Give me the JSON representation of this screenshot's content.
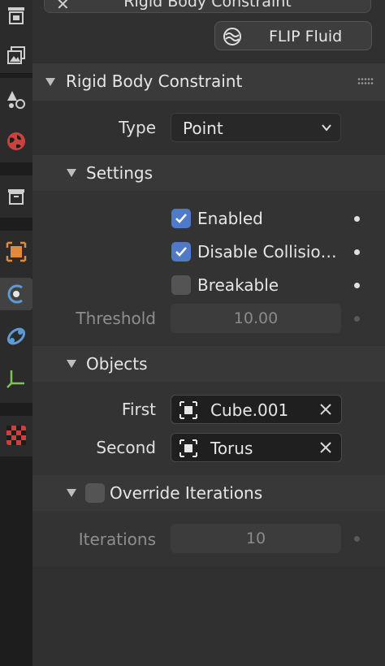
{
  "top_strip": {
    "close_glyph": "✕",
    "label": "Rigid Body Constraint"
  },
  "flip_button": {
    "label": "FLIP Fluid",
    "icon": "flip-fluid-icon"
  },
  "panel": {
    "title": "Rigid Body Constraint"
  },
  "type_row": {
    "label": "Type",
    "value": "Point"
  },
  "settings": {
    "title": "Settings",
    "enabled": {
      "label": "Enabled",
      "checked": true
    },
    "disable_collisions": {
      "label": "Disable Collisio…",
      "checked": true
    },
    "breakable": {
      "label": "Breakable",
      "checked": false
    },
    "threshold": {
      "label": "Threshold",
      "value": "10.00"
    }
  },
  "objects": {
    "title": "Objects",
    "first": {
      "label": "First",
      "value": "Cube.001"
    },
    "second": {
      "label": "Second",
      "value": "Torus"
    }
  },
  "override_iterations": {
    "title": "Override Iterations",
    "checked": false,
    "iterations": {
      "label": "Iterations",
      "value": "10"
    }
  },
  "sidebar_tabs": [
    "render-output-icon",
    "view-layer-icon",
    "scene-icon",
    "world-icon",
    "collection-icon",
    "object-icon",
    "physics-icon",
    "constraints-icon",
    "object-data-icon",
    "material-icon"
  ],
  "colors": {
    "accent_checkbox": "#4f7ac7",
    "active_tab": "#424242",
    "panel_bg": "#303030"
  }
}
